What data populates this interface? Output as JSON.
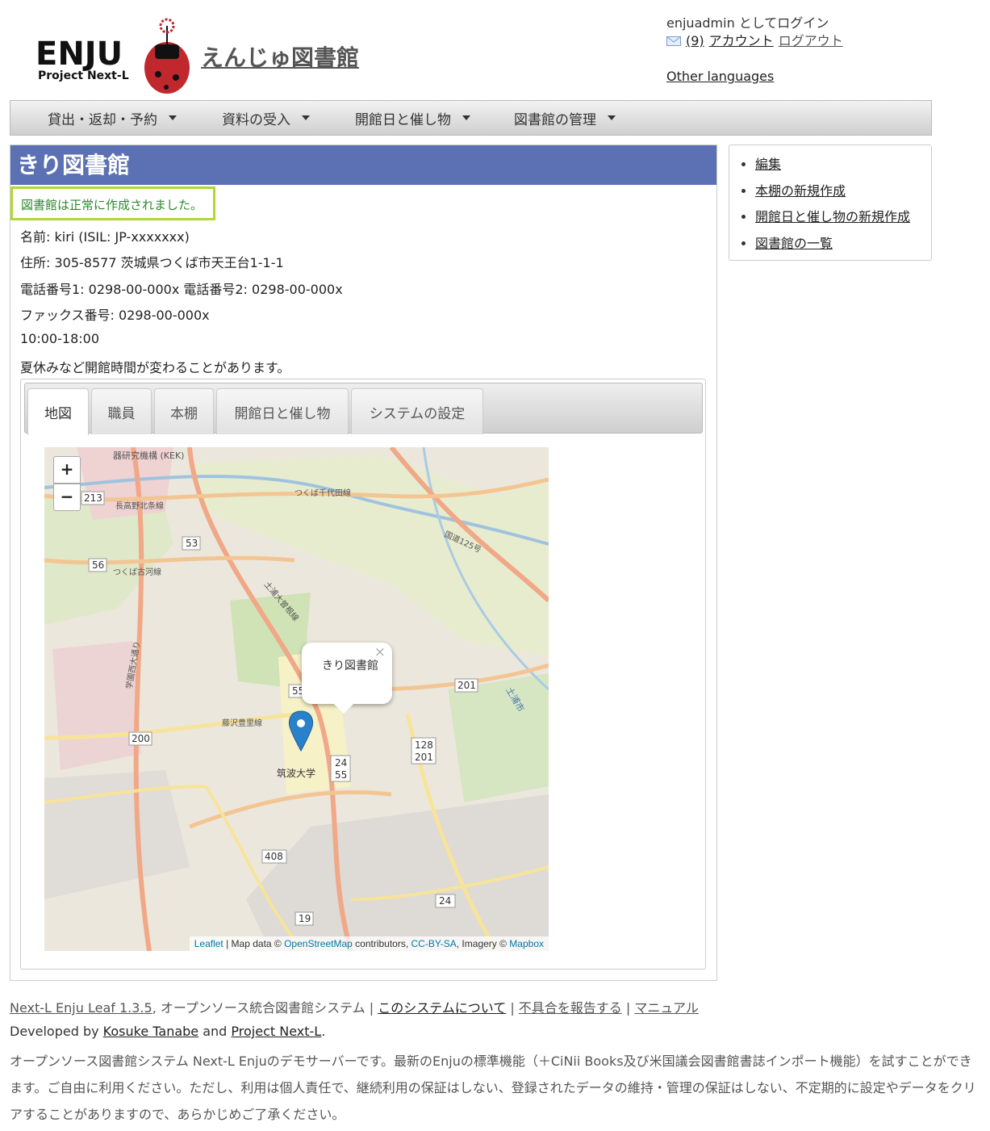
{
  "header": {
    "logo_text": "ENJU",
    "logo_subtext": "Project Next-L",
    "site_title": "えんじゅ図書館",
    "login_text": "enjuadmin としてログイン",
    "message_count": "(9)",
    "account_link": "アカウント",
    "logout_link": "ログアウト",
    "languages_link": "Other languages"
  },
  "menu": {
    "items": [
      {
        "label": "貸出・返却・予約"
      },
      {
        "label": "資料の受入"
      },
      {
        "label": "開館日と催し物"
      },
      {
        "label": "図書館の管理"
      }
    ]
  },
  "library": {
    "title": "きり図書館",
    "notice": "図書館は正常に作成されました。",
    "name_line": "名前: kiri (ISIL: JP-xxxxxxx)",
    "address_line": "住所: 305-8577 茨城県つくば市天王台1-1-1",
    "phone_line": "電話番号1: 0298-00-000x 電話番号2: 0298-00-000x",
    "fax_line": "ファックス番号: 0298-00-000x",
    "hours_line": "10:00-18:00",
    "note_line": "夏休みなど開館時間が変わることがあります。"
  },
  "tabs": [
    {
      "label": "地図",
      "active": true
    },
    {
      "label": "職員"
    },
    {
      "label": "本棚"
    },
    {
      "label": "開館日と催し物"
    },
    {
      "label": "システムの設定"
    }
  ],
  "map": {
    "zoom_in": "+",
    "zoom_out": "−",
    "popup_text": "きり図書館",
    "popup_close": "×",
    "attribution": {
      "leaflet": "Leaflet",
      "sep1": " | Map data © ",
      "osm": "OpenStreetMap",
      "contrib": " contributors, ",
      "license": "CC-BY-SA",
      "imagery": ", Imagery © ",
      "mapbox": "Mapbox"
    },
    "labels": {
      "kek": "器研究機構 (KEK)",
      "r213": "213",
      "nagamine": "長高野北条線",
      "chiyoda": "つくば千代田線",
      "kokudo125": "国道125号",
      "r53": "53",
      "r56": "56",
      "tsukuba_koga": "つくば古河線",
      "tsuchiura_oya": "土浦大曽根線",
      "r201": "201",
      "r55": "55",
      "fujisawa_toyosato": "藤沢豊里線",
      "r200": "200",
      "r128_201": "128\n201",
      "r24_55": "24\n55",
      "tsukuba_univ": "筑波大学",
      "r408": "408",
      "r19": "19",
      "r24": "24",
      "gakuen_nishi": "学園西大通り",
      "tsuchiura_city": "土浦市"
    }
  },
  "sidebar": {
    "items": [
      {
        "label": "編集"
      },
      {
        "label": "本棚の新規作成"
      },
      {
        "label": "開館日と催し物の新規作成"
      },
      {
        "label": "図書館の一覧"
      }
    ]
  },
  "footer": {
    "product_link": "Next-L Enju Leaf 1.3.5",
    "product_desc": ", オープンソース統合図書館システム | ",
    "about_link": "このシステムについて",
    "sep": " | ",
    "report_link": "不具合を報告する",
    "manual_link": "マニュアル",
    "dev_prefix": "Developed by ",
    "dev_author": "Kosuke Tanabe",
    "dev_and": " and ",
    "dev_project": "Project Next-L",
    "dev_suffix": ".",
    "description": "オープンソース図書館システム Next-L Enjuのデモサーバーです。最新のEnjuの標準機能（＋CiNii Books及び米国議会図書館書誌インポート機能）を試すことができます。ご自由に利用ください。ただし、利用は個人責任で、継続利用の保証はしない、登録されたデータの維持・管理の保証はしない、不定期的に設定やデータをクリアすることがありますので、あらかじめご了承ください。"
  },
  "colors": {
    "header_bar": "#5b71b3",
    "notice_border": "#b0d832",
    "notice_text": "#2b8a2b",
    "link_blue": "#0078a8"
  }
}
